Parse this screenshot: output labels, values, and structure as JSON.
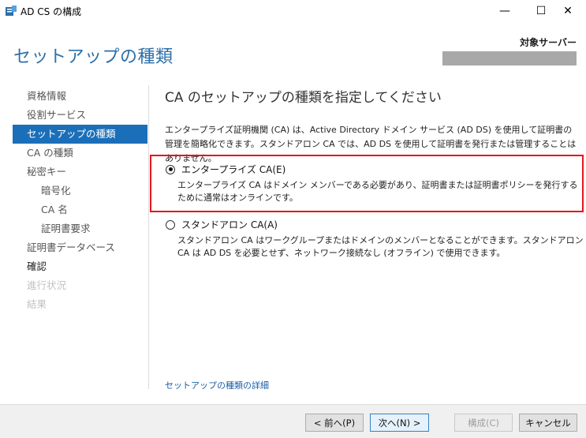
{
  "window": {
    "title": "AD CS の構成",
    "min_symbol": "—",
    "max_symbol": "☐",
    "close_symbol": "✕"
  },
  "header": {
    "title": "セットアップの種類",
    "target_label": "対象サーバー"
  },
  "nav": {
    "items": [
      {
        "label": "資格情報",
        "state": "normal"
      },
      {
        "label": "役割サービス",
        "state": "normal"
      },
      {
        "label": "セットアップの種類",
        "state": "active"
      },
      {
        "label": "CA の種類",
        "state": "normal"
      },
      {
        "label": "秘密キー",
        "state": "normal"
      },
      {
        "label": "暗号化",
        "state": "sub"
      },
      {
        "label": "CA 名",
        "state": "sub"
      },
      {
        "label": "証明書要求",
        "state": "sub"
      },
      {
        "label": "証明書データベース",
        "state": "normal"
      },
      {
        "label": "確認",
        "state": "current"
      },
      {
        "label": "進行状況",
        "state": "disabled"
      },
      {
        "label": "結果",
        "state": "disabled"
      }
    ]
  },
  "content": {
    "heading": "CA のセットアップの種類を指定してください",
    "description": "エンタープライズ証明機関 (CA) は、Active Directory ドメイン サービス (AD DS) を使用して証明書の管理を簡略化できます。スタンドアロン CA では、AD DS を使用して証明書を発行または管理することはありません。",
    "options": {
      "enterprise": {
        "label": "エンタープライズ CA(E)",
        "description": "エンタープライズ CA はドメイン メンバーである必要があり、証明書または証明書ポリシーを発行するために通常はオンラインです。",
        "selected": true
      },
      "standalone": {
        "label": "スタンドアロン CA(A)",
        "description": "スタンドアロン CA はワークグループまたはドメインのメンバーとなることができます。スタンドアロン CA は AD DS を必要とせず、ネットワーク接続なし (オフライン) で使用できます。",
        "selected": false
      }
    },
    "more_link": "セットアップの種類の詳細"
  },
  "footer": {
    "prev": "< 前へ(P)",
    "next": "次へ(N) >",
    "finish": "構成(C)",
    "cancel": "キャンセル"
  },
  "colors": {
    "accent": "#1b6fb9",
    "title_blue": "#2c6fa8",
    "highlight_red": "#e5161b"
  }
}
